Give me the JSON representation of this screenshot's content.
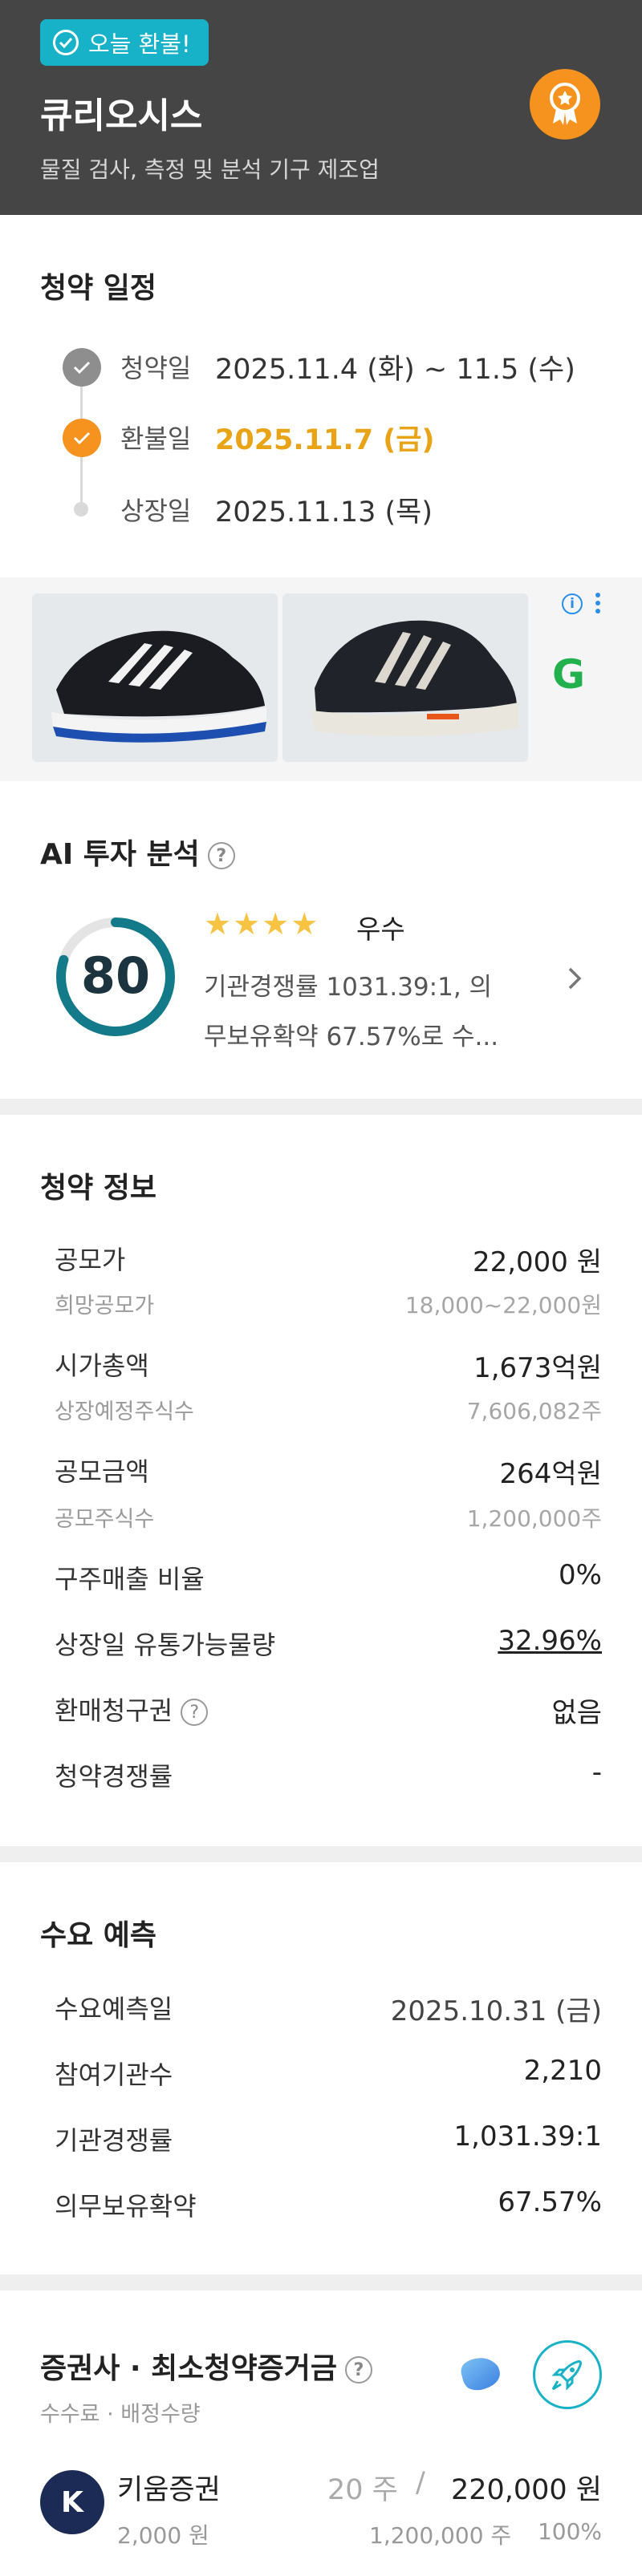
{
  "header": {
    "badge": "오늘 환불!",
    "company": "큐리오시스",
    "description": "물질 검사, 측정 및 분석 기구 제조업"
  },
  "schedule": {
    "title": "청약 일정",
    "items": [
      {
        "label": "청약일",
        "value": "2025.11.4 (화) ~ 11.5 (수)",
        "status": "done"
      },
      {
        "label": "환불일",
        "value": "2025.11.7 (금)",
        "status": "today"
      },
      {
        "label": "상장일",
        "value": "2025.11.13 (목)",
        "status": "upcoming"
      }
    ]
  },
  "ad": {
    "brand_letter": "G",
    "info_icon": "info-icon"
  },
  "ai": {
    "title": "AI 투자 분석",
    "score": "80",
    "score_ratio": 0.8,
    "stars": "★★★★",
    "star_count": 4,
    "grade": "우수",
    "summary_line1": "기관경쟁률 1031.39:1, 의",
    "summary_line2": "무보유확약 67.57%로 수..."
  },
  "subscription": {
    "title": "청약 정보",
    "offer_price_label": "공모가",
    "offer_price": "22,000 원",
    "hope_price_label": "희망공모가",
    "hope_price": "18,000~22,000원",
    "market_cap_label": "시가총액",
    "market_cap": "1,673억원",
    "listed_shares_label": "상장예정주식수",
    "listed_shares": "7,606,082주",
    "offer_amount_label": "공모금액",
    "offer_amount": "264억원",
    "offer_shares_label": "공모주식수",
    "offer_shares": "1,200,000주",
    "old_share_label": "구주매출 비율",
    "old_share": "0%",
    "float_label": "상장일 유통가능물량",
    "float": "32.96%",
    "putback_label": "환매청구권",
    "putback": "없음",
    "competition_label": "청약경쟁률",
    "competition": "-"
  },
  "demand": {
    "title": "수요 예측",
    "date_label": "수요예측일",
    "date": "2025.10.31 (금)",
    "inst_label": "참여기관수",
    "inst": "2,210",
    "ratio_label": "기관경쟁률",
    "ratio": "1,031.39:1",
    "lockup_label": "의무보유확약",
    "lockup": "67.57%"
  },
  "brokers": {
    "title": "증권사 · 최소청약증거금",
    "subtitle": "수수료 · 배정수량",
    "items": [
      {
        "logo": "K",
        "name": "키움증권",
        "fee": "2,000 원",
        "min_shares": "20 주",
        "slash": "/",
        "min_deposit": "220,000 원",
        "alloc_shares": "1,200,000 주",
        "alloc_pct": "100%"
      }
    ]
  },
  "colors": {
    "accent": "#17b2c7",
    "orange": "#f6921e",
    "header_bg": "#454545",
    "highlight": "#e8a317",
    "score_ring": "#137a8a"
  }
}
